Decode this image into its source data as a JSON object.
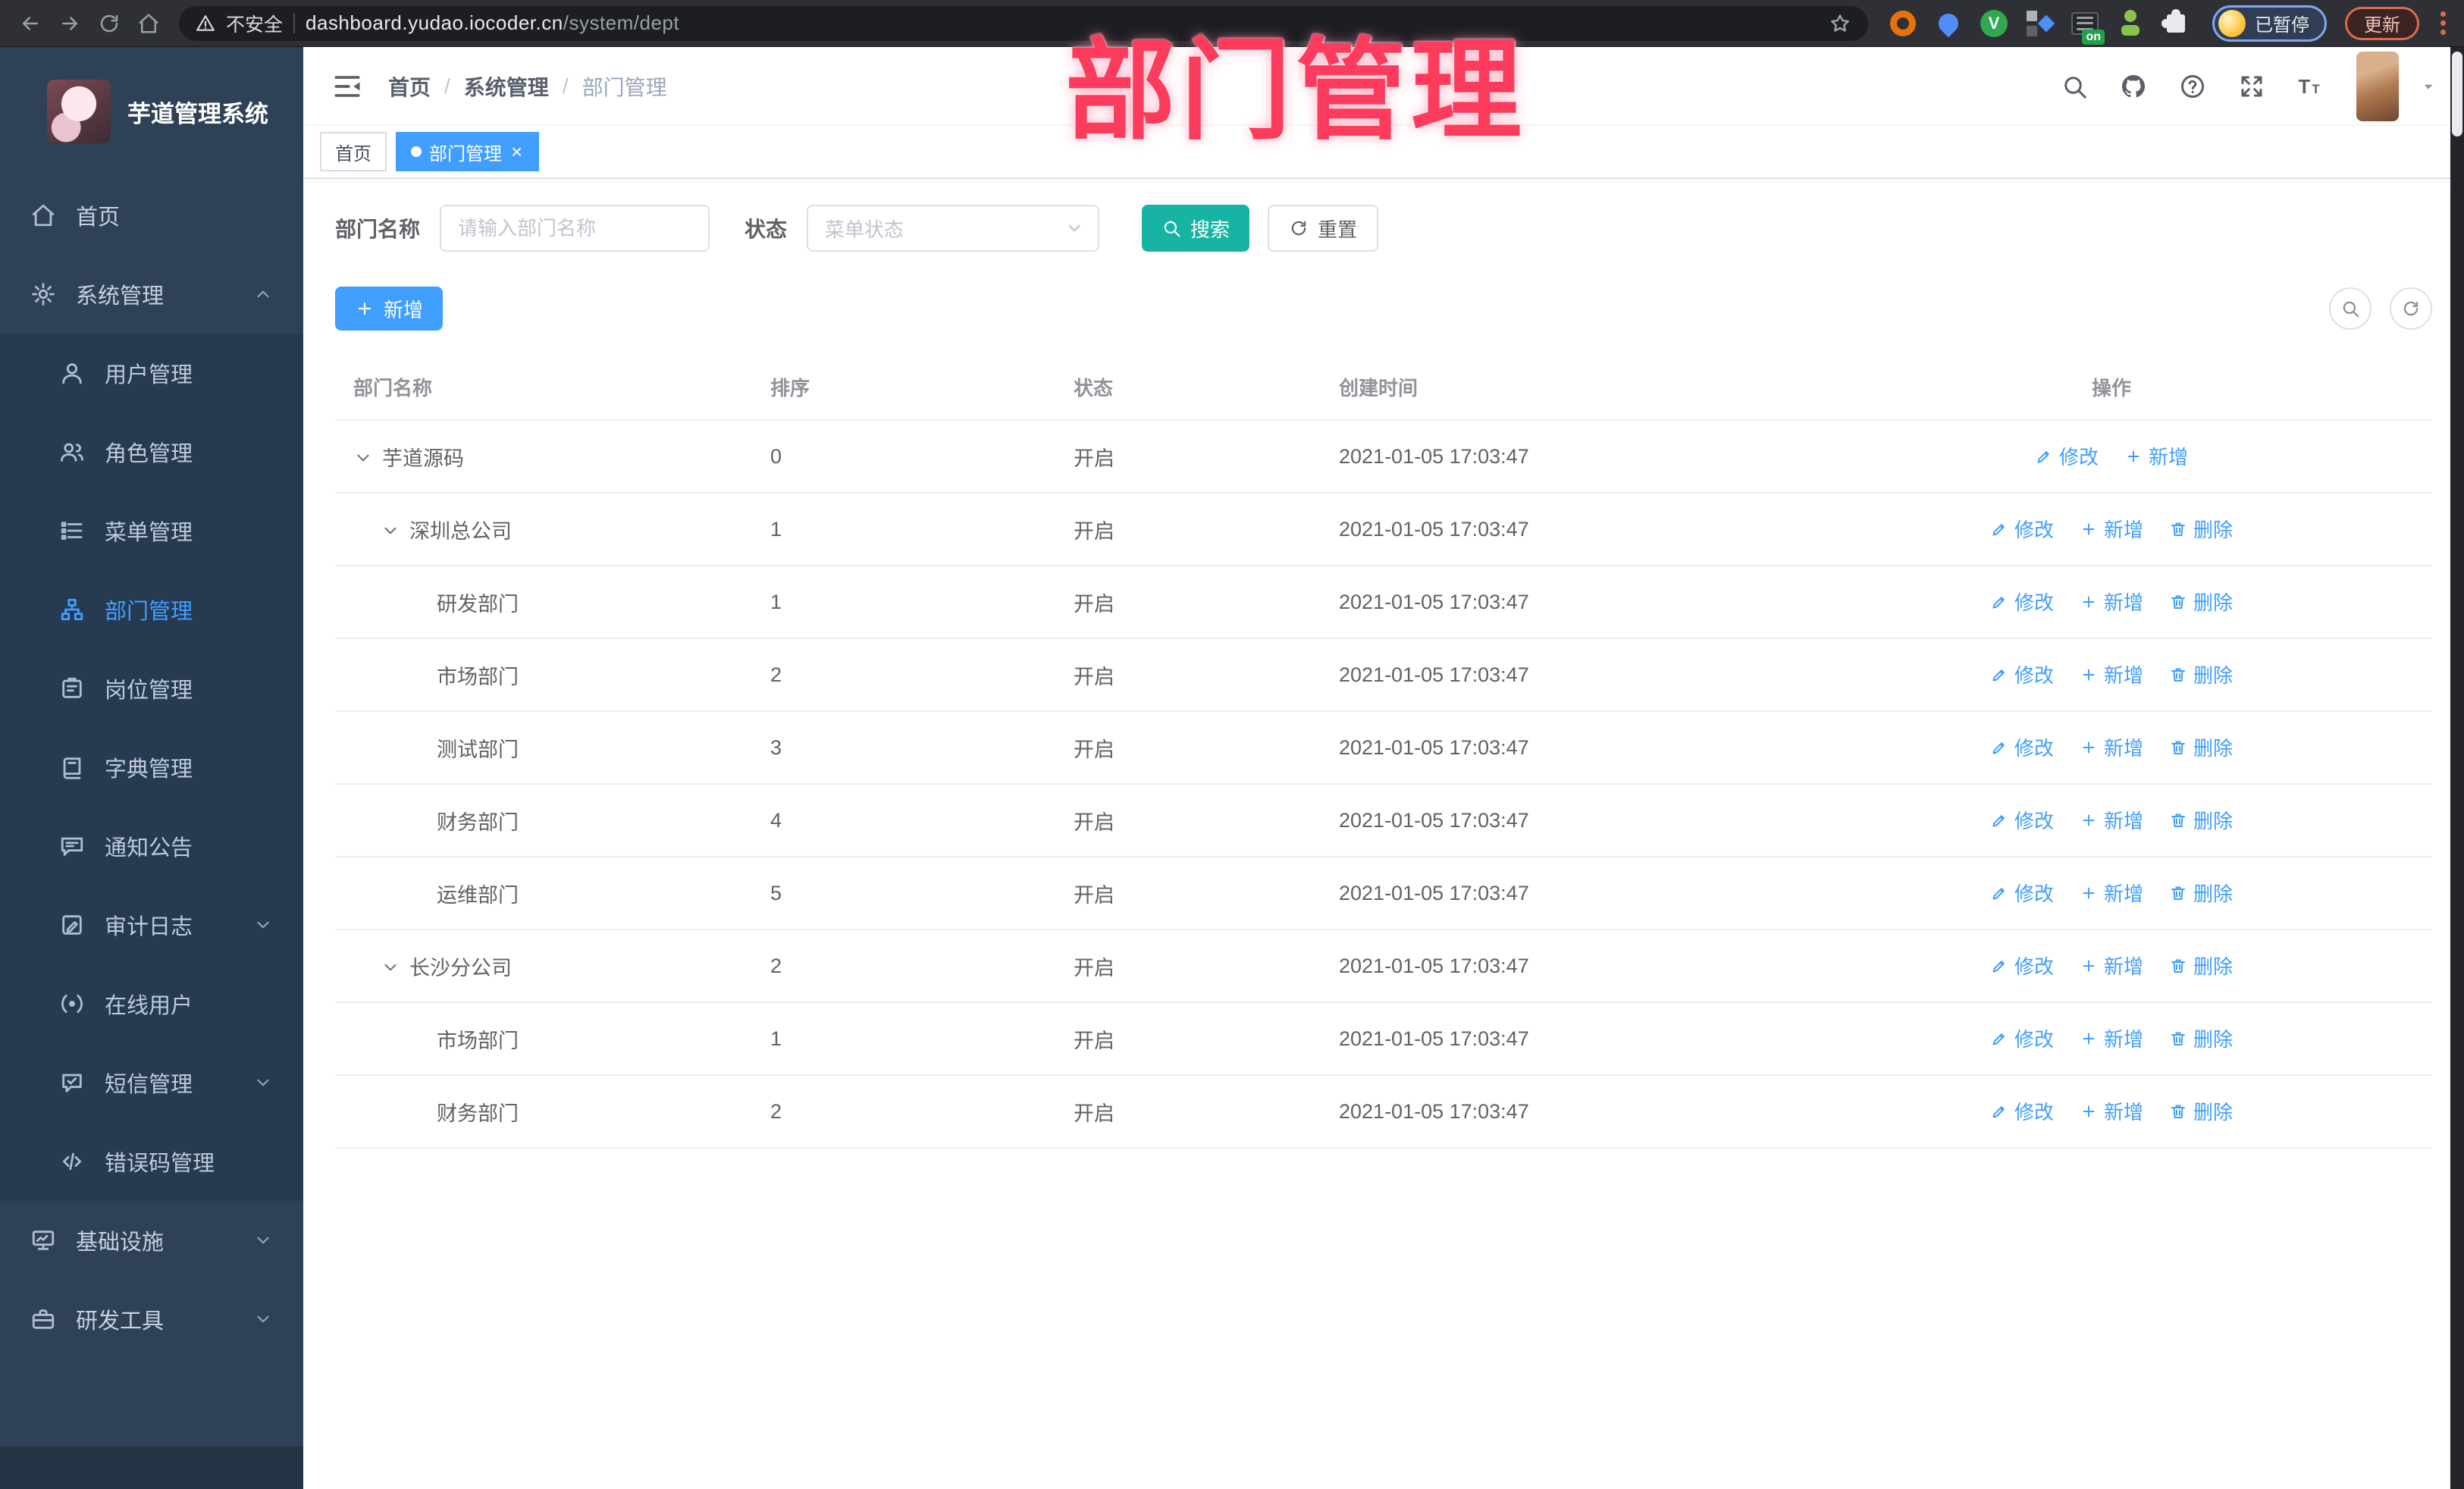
{
  "browser": {
    "nav_icons": [
      "back",
      "forward",
      "reload",
      "home"
    ],
    "security_label": "不安全",
    "url_host": "dashboard.yudao.iocoder.cn",
    "url_path": "/system/dept",
    "bookmark_icon": "star",
    "extensions": [
      {
        "icon": "ext-orange-ring"
      },
      {
        "icon": "ext-blue-pin"
      },
      {
        "icon": "ext-green-circle"
      },
      {
        "icon": "ext-blue-grid"
      },
      {
        "icon": "ext-list",
        "badge": "on"
      },
      {
        "icon": "ext-green-bot"
      },
      {
        "icon": "ext-puzzle"
      }
    ],
    "profile_label": "已暂停",
    "update_label": "更新"
  },
  "annotation": {
    "text": "部门管理"
  },
  "sidebar": {
    "title": "芋道管理系统",
    "menu": [
      {
        "label": "首页",
        "icon": "home"
      },
      {
        "label": "系统管理",
        "icon": "gear",
        "chevron": "up",
        "children": [
          {
            "label": "用户管理",
            "icon": "user"
          },
          {
            "label": "角色管理",
            "icon": "users"
          },
          {
            "label": "菜单管理",
            "icon": "menu-list"
          },
          {
            "label": "部门管理",
            "icon": "org",
            "active": true
          },
          {
            "label": "岗位管理",
            "icon": "badge"
          },
          {
            "label": "字典管理",
            "icon": "book"
          },
          {
            "label": "通知公告",
            "icon": "announce"
          },
          {
            "label": "审计日志",
            "icon": "log",
            "chevron": "down"
          },
          {
            "label": "在线用户",
            "icon": "online"
          },
          {
            "label": "短信管理",
            "icon": "sms",
            "chevron": "down"
          },
          {
            "label": "错误码管理",
            "icon": "code"
          }
        ]
      },
      {
        "label": "基础设施",
        "icon": "infra",
        "chevron": "down"
      },
      {
        "label": "研发工具",
        "icon": "tools",
        "chevron": "down"
      }
    ]
  },
  "header": {
    "breadcrumb": [
      "首页",
      "系统管理",
      "部门管理"
    ],
    "separator": "/",
    "icons": [
      "search",
      "github",
      "question",
      "fullscreen",
      "font-size"
    ]
  },
  "tags": [
    {
      "label": "首页",
      "active": false,
      "closable": false
    },
    {
      "label": "部门管理",
      "active": true,
      "closable": true,
      "close_glyph": "×"
    }
  ],
  "filters": {
    "name_label": "部门名称",
    "name_placeholder": "请输入部门名称",
    "status_label": "状态",
    "status_placeholder": "菜单状态",
    "search_label": "搜索",
    "reset_label": "重置"
  },
  "toolbar": {
    "add_label": "新增",
    "icon_buttons": [
      "search",
      "refresh"
    ]
  },
  "table": {
    "columns": [
      "部门名称",
      "排序",
      "状态",
      "创建时间",
      "操作"
    ],
    "action_labels": {
      "edit": "修改",
      "add": "新增",
      "delete": "删除"
    },
    "rows": [
      {
        "name": "芋道源码",
        "level": 0,
        "expandable": true,
        "sort": "0",
        "status": "开启",
        "created": "2021-01-05 17:03:47",
        "actions": [
          "edit",
          "add"
        ]
      },
      {
        "name": "深圳总公司",
        "level": 1,
        "expandable": true,
        "sort": "1",
        "status": "开启",
        "created": "2021-01-05 17:03:47",
        "actions": [
          "edit",
          "add",
          "delete"
        ]
      },
      {
        "name": "研发部门",
        "level": 2,
        "expandable": false,
        "sort": "1",
        "status": "开启",
        "created": "2021-01-05 17:03:47",
        "actions": [
          "edit",
          "add",
          "delete"
        ]
      },
      {
        "name": "市场部门",
        "level": 2,
        "expandable": false,
        "sort": "2",
        "status": "开启",
        "created": "2021-01-05 17:03:47",
        "actions": [
          "edit",
          "add",
          "delete"
        ]
      },
      {
        "name": "测试部门",
        "level": 2,
        "expandable": false,
        "sort": "3",
        "status": "开启",
        "created": "2021-01-05 17:03:47",
        "actions": [
          "edit",
          "add",
          "delete"
        ]
      },
      {
        "name": "财务部门",
        "level": 2,
        "expandable": false,
        "sort": "4",
        "status": "开启",
        "created": "2021-01-05 17:03:47",
        "actions": [
          "edit",
          "add",
          "delete"
        ]
      },
      {
        "name": "运维部门",
        "level": 2,
        "expandable": false,
        "sort": "5",
        "status": "开启",
        "created": "2021-01-05 17:03:47",
        "actions": [
          "edit",
          "add",
          "delete"
        ]
      },
      {
        "name": "长沙分公司",
        "level": 1,
        "expandable": true,
        "sort": "2",
        "status": "开启",
        "created": "2021-01-05 17:03:47",
        "actions": [
          "edit",
          "add",
          "delete"
        ]
      },
      {
        "name": "市场部门",
        "level": 2,
        "expandable": false,
        "sort": "1",
        "status": "开启",
        "created": "2021-01-05 17:03:47",
        "actions": [
          "edit",
          "add",
          "delete"
        ]
      },
      {
        "name": "财务部门",
        "level": 2,
        "expandable": false,
        "sort": "2",
        "status": "开启",
        "created": "2021-01-05 17:03:47",
        "actions": [
          "edit",
          "add",
          "delete"
        ]
      }
    ]
  },
  "colors": {
    "accent": "#409eff",
    "search_button": "#17b3a3",
    "annotation": "#fd3b5c",
    "sidebar_bg": "#2f4156",
    "submenu_bg": "#263a51"
  }
}
